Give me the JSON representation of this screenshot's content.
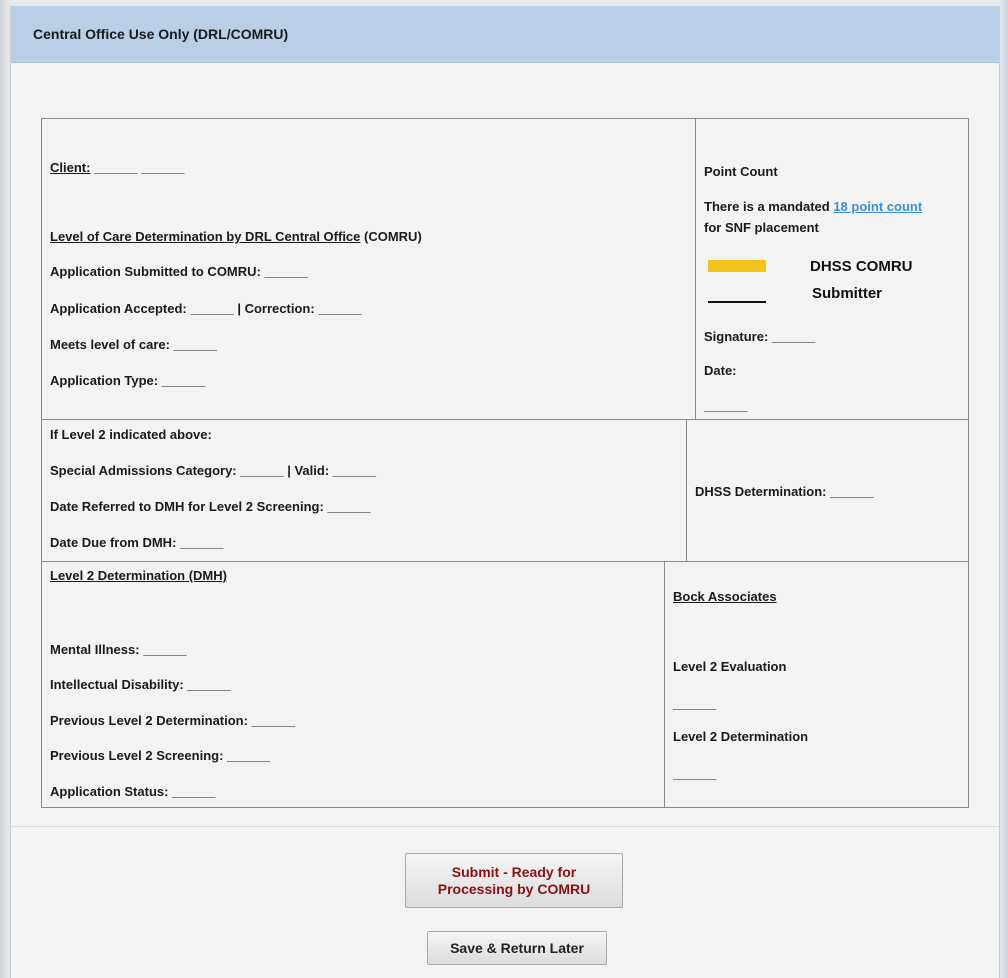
{
  "header": {
    "title": "Central Office Use Only (DRL/COMRU)"
  },
  "section1": {
    "client_label": "Client:",
    "client_value": "______ ______",
    "loc_heading_underlined": "Level of Care Determination by DRL Central Office",
    "loc_heading_suffix": "(COMRU)",
    "app_submitted": "Application Submitted to COMRU: ______",
    "app_accepted": "Application Accepted: ______  |  Correction: ______",
    "meets_loc": "Meets level of care: ______",
    "app_type": "Application Type: ______",
    "point_count_title": "Point Count",
    "mandated_prefix": "There is a mandated ",
    "mandated_link": "18 point count",
    "mandated_suffix": "for SNF placement",
    "legend": [
      {
        "label": "DHSS COMRU",
        "style": "swatch",
        "color": "#f2c318"
      },
      {
        "label": "Submitter",
        "style": "line",
        "color": "#111111"
      }
    ],
    "signature": "Signature: ______",
    "date_label": "Date:",
    "date_value": "______"
  },
  "section2": {
    "if_level2": "If Level 2 indicated above:",
    "special_admissions": "Special Admissions Category: ______   |   Valid: ______",
    "date_referred": "Date Referred to DMH for Level 2 Screening: ______",
    "date_due": "Date Due from DMH: ______",
    "dhss_determination": "DHSS Determination: ______"
  },
  "section3": {
    "heading": "Level 2 Determination (DMH)",
    "mental_illness": "Mental Illness: ______",
    "intellectual_disability": "Intellectual Disability: ______",
    "prev_determination": "Previous Level 2 Determination: ______",
    "prev_screening": "Previous Level 2 Screening: ______",
    "app_status": "Application Status: ______",
    "bock_heading": "Bock Associates",
    "level2_eval": "Level 2 Evaluation",
    "level2_eval_value": "______",
    "level2_det": "Level 2 Determination",
    "level2_det_value": "______"
  },
  "buttons": {
    "submit_line1": "Submit - Ready for",
    "submit_line2": "Processing by COMRU",
    "save": "Save & Return Later"
  }
}
